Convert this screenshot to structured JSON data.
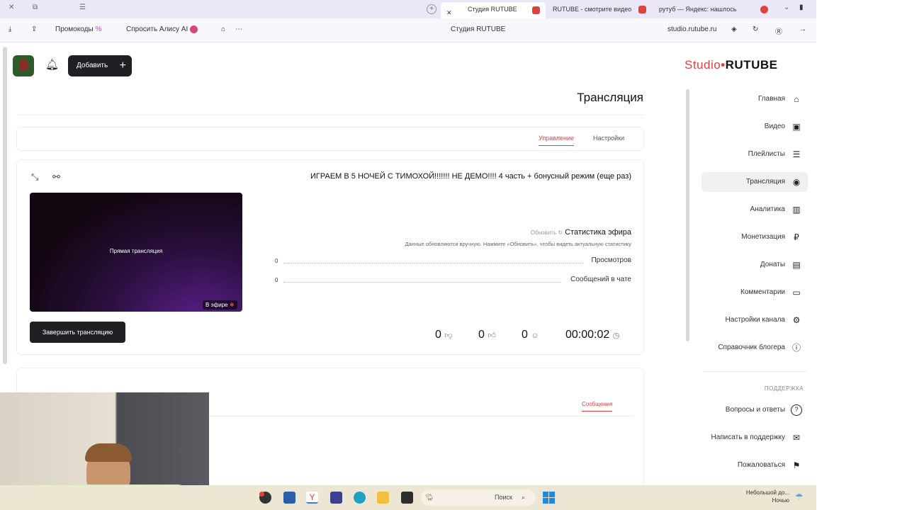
{
  "browser": {
    "tabs": [
      {
        "label": "Студия RUTUBE"
      },
      {
        "label": "RUTUBE - смотрите видео"
      },
      {
        "label": "рутуб — Яндекс: нашлось"
      }
    ],
    "toolbar": {
      "url": "studio.rutube.ru",
      "page_title": "Студия RUTUBE",
      "ask_alice": "Спросить Алису AI",
      "promocodes": "Промокоды"
    }
  },
  "header": {
    "logo_main": "RUTUBE",
    "logo_sub": "Studio",
    "add_button": "Добавить"
  },
  "sidebar": {
    "items": [
      {
        "label": "Главная",
        "icon": "home-icon",
        "glyph": "⌂"
      },
      {
        "label": "Видео",
        "icon": "video-icon",
        "glyph": "▣"
      },
      {
        "label": "Плейлисты",
        "icon": "playlist-icon",
        "glyph": "☰"
      },
      {
        "label": "Трансляция",
        "icon": "broadcast-icon",
        "glyph": "◉"
      },
      {
        "label": "Аналитика",
        "icon": "analytics-icon",
        "glyph": "▥"
      },
      {
        "label": "Монетизация",
        "icon": "monetization-icon",
        "glyph": "₽"
      },
      {
        "label": "Донаты",
        "icon": "donations-icon",
        "glyph": "▤"
      },
      {
        "label": "Комментарии",
        "icon": "comments-icon",
        "glyph": "▭"
      },
      {
        "label": "Настройки канала",
        "icon": "settings-icon",
        "glyph": "⚙"
      },
      {
        "label": "Справочник блогера",
        "icon": "info-icon",
        "glyph": "ⓘ"
      }
    ],
    "support_heading": "ПОДДЕРЖКА",
    "support_items": [
      {
        "label": "Вопросы и ответы",
        "icon": "question-icon",
        "glyph": "?"
      },
      {
        "label": "Написать в поддержку",
        "icon": "mail-icon",
        "glyph": "✉"
      },
      {
        "label": "Пожаловаться",
        "icon": "flag-icon",
        "glyph": "⚑"
      }
    ]
  },
  "main": {
    "page_title": "Трансляция",
    "tabs": [
      {
        "label": "Управление"
      },
      {
        "label": "Настройки"
      }
    ],
    "stream": {
      "title": "ИГРАЕМ В 5 НОЧЕЙ С ТИМОХОЙ!!!!!!! НЕ ДЕМО!!!! 4 часть + бонусный режим (еще раз)",
      "preview_label": "Прямая трансляция",
      "live_badge": "В эфире",
      "stats_heading": "Статистика эфира",
      "refresh_label": "Обновить",
      "stats_note": "Данные обновляются вручную. Нажмите «Обновить», чтобы видеть актуальную статистику",
      "views_label": "Просмотров",
      "views_value": "0",
      "chat_label": "Сообщений в чате",
      "chat_value": "0",
      "end_button": "Завершить трансляцию",
      "duration": "00:00:02",
      "viewers": "0",
      "likes": "0",
      "dislikes": "0"
    },
    "chat_tab": "Сообщения"
  },
  "taskbar": {
    "search_placeholder": "Поиск",
    "weather_line1": "Небольшой до...",
    "weather_line2": "Ночью"
  },
  "colors": {
    "accent": "#e0413c",
    "dark_button": "#1f1f24",
    "sidebar_active": "#f0f0f2"
  }
}
